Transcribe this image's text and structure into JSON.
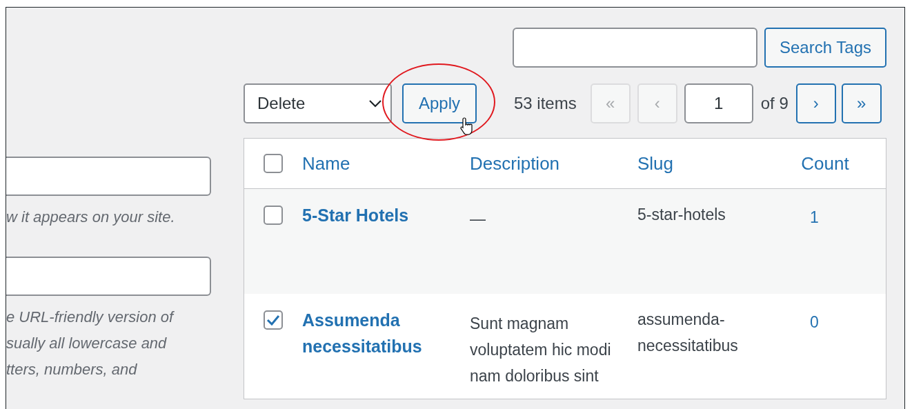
{
  "left_form": {
    "sections": [
      {
        "help_lines": [
          "w it appears on your site."
        ]
      },
      {
        "help_lines": [
          "e URL-friendly version of",
          "sually all lowercase and",
          "tters, numbers, and"
        ]
      }
    ]
  },
  "search": {
    "button": "Search Tags"
  },
  "bulk_actions": {
    "selected": "Delete",
    "apply": "Apply",
    "highlighted": true
  },
  "pagination": {
    "items_count": "53 items",
    "current_page": "1",
    "of": "of 9",
    "buttons_before": [
      {
        "label": "«",
        "disabled": true
      },
      {
        "label": "‹",
        "disabled": true
      }
    ],
    "buttons_after": [
      {
        "label": "›",
        "disabled": false
      },
      {
        "label": "»",
        "disabled": false
      }
    ]
  },
  "table": {
    "select_all_checked": false,
    "columns": [
      "Name",
      "Description",
      "Slug",
      "Count"
    ],
    "rows": [
      {
        "checked": false,
        "name": "5-Star Hotels",
        "description": "—",
        "slug": "5-star-hotels",
        "count": "1"
      },
      {
        "checked": true,
        "name": "Assumenda necessitatibus",
        "description": "Sunt magnam voluptatem hic modi nam doloribus sint",
        "slug": "assumenda-necessitatibus",
        "count": "0"
      }
    ]
  }
}
